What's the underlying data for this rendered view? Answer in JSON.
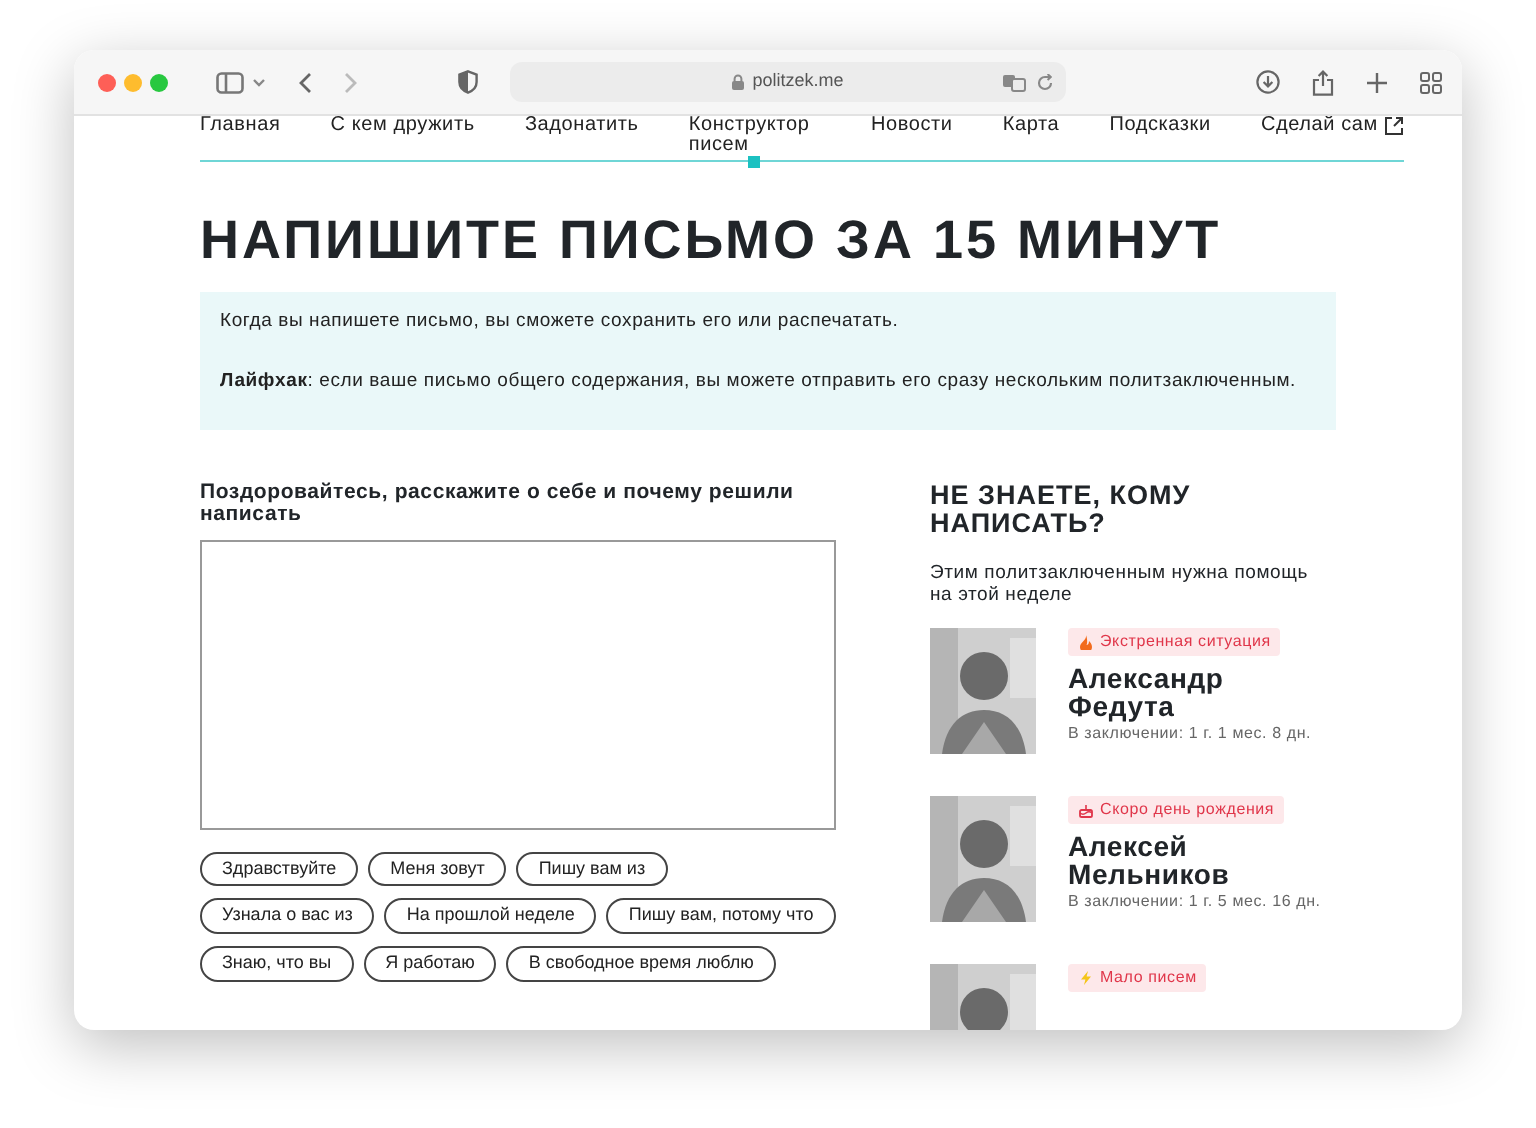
{
  "browser": {
    "url": "politzek.me"
  },
  "nav": [
    {
      "label": "Главная",
      "selected": false,
      "external": false
    },
    {
      "label": "С кем дружить",
      "selected": false,
      "external": false
    },
    {
      "label": "Задонатить",
      "selected": false,
      "external": false
    },
    {
      "label": "Конструктор писем",
      "selected": true,
      "external": false
    },
    {
      "label": "Новости",
      "selected": false,
      "external": false
    },
    {
      "label": "Карта",
      "selected": false,
      "external": false
    },
    {
      "label": "Подсказки",
      "selected": false,
      "external": false
    },
    {
      "label": "Сделай сам",
      "selected": false,
      "external": true
    }
  ],
  "title": "НАПИШИТЕ ПИСЬМО ЗА 15 МИНУТ",
  "info": {
    "text": "Когда вы напишете письмо, вы сможете сохранить его или распечатать.",
    "lifehack": "**Лайфхак**: если ваше письмо общего содержания, вы можете отправить его сразу нескольким политзаключенным."
  },
  "letter": {
    "label": "Поздоровайтесь, расскажите о себе и почему решили написать",
    "phrases": [
      "Здравствуйте",
      "Меня зовут",
      "Пишу вам из",
      "Узнала о вас из",
      "На прошлой неделе",
      "Пишу вам, потому что",
      "Знаю, что вы",
      "Я работаю",
      "В свободное время люблю"
    ]
  },
  "sidebar": {
    "title": "НЕ ЗНАЕТЕ, КОМУ НАПИСАТЬ?",
    "subtitle": "Этим политзаключенным нужна помощь на этой неделе",
    "prisoners": [
      {
        "tag": "Экстренная ситуация",
        "kind": "fire",
        "name": "Александр Федута",
        "term": "В заключении: 1 г. 1 мес. 8 дн."
      },
      {
        "tag": "Скоро день рождения",
        "kind": "cake",
        "name": "Алексей Мельников",
        "term": "В заключении: 1 г. 5 мес. 16 дн."
      },
      {
        "tag": "Мало писем",
        "kind": "bolt"
      }
    ]
  }
}
